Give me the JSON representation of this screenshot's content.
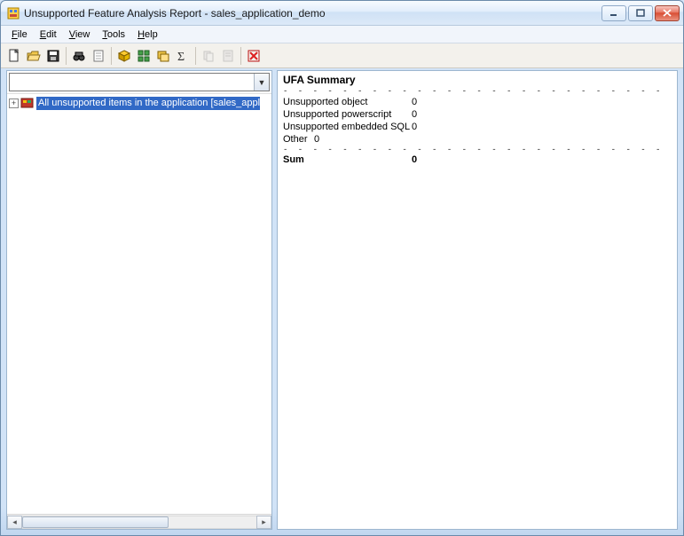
{
  "window": {
    "title": "Unsupported Feature Analysis Report - sales_application_demo"
  },
  "menu": {
    "file": "File",
    "edit": "Edit",
    "view": "View",
    "tools": "Tools",
    "help": "Help"
  },
  "tree": {
    "root_label": "All unsupported items in the application [sales_applicat"
  },
  "summary": {
    "title": "UFA Summary",
    "rows": [
      {
        "label": "Unsupported object",
        "value": "0"
      },
      {
        "label": "Unsupported powerscript",
        "value": "0"
      },
      {
        "label": "Unsupported embedded SQL",
        "value": "0"
      }
    ],
    "other_label": "Other",
    "other_value": "0",
    "sum_label": "Sum",
    "sum_value": "0"
  }
}
